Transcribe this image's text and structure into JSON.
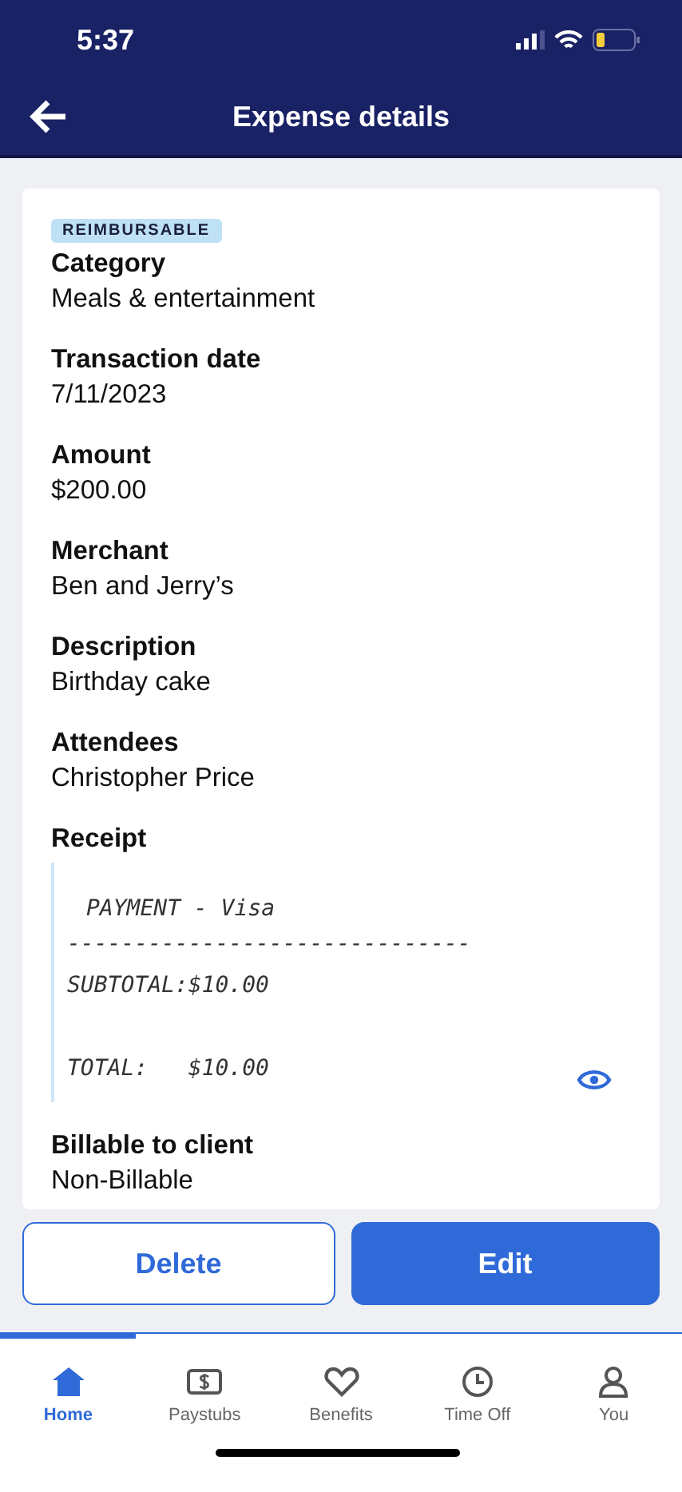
{
  "status_bar": {
    "time": "5:37"
  },
  "header": {
    "title": "Expense details"
  },
  "badge": "REIMBURSABLE",
  "fields": [
    {
      "label": "Category",
      "value": "Meals & entertainment"
    },
    {
      "label": "Transaction date",
      "value": "7/11/2023"
    },
    {
      "label": "Amount",
      "value": "$200.00"
    },
    {
      "label": "Merchant",
      "value": "Ben and Jerry’s"
    },
    {
      "label": "Description",
      "value": "Birthday cake"
    },
    {
      "label": "Attendees",
      "value": "Christopher Price"
    }
  ],
  "receipt": {
    "label": "Receipt",
    "lines": [
      {
        "text": "PAYMENT - Visa",
        "kind": "line"
      },
      {
        "text": "------------------------------",
        "kind": "line"
      },
      {
        "text": "SUBTOTAL:$10.00",
        "kind": "line"
      },
      {
        "text": "TOTAL:   $10.00",
        "kind": "spaced"
      }
    ]
  },
  "billable": {
    "label": "Billable to client",
    "value": "Non-Billable"
  },
  "buttons": [
    {
      "label": "Delete",
      "kind": "secondary"
    },
    {
      "label": "Edit",
      "kind": "primary"
    }
  ],
  "tabs": [
    {
      "label": "Home",
      "kind": "home",
      "selected": true
    },
    {
      "label": "Paystubs",
      "kind": "paystub",
      "selected": false
    },
    {
      "label": "Benefits",
      "kind": "heart",
      "selected": false
    },
    {
      "label": "Time Off",
      "kind": "clock",
      "selected": false
    },
    {
      "label": "You",
      "kind": "person",
      "selected": false
    }
  ]
}
